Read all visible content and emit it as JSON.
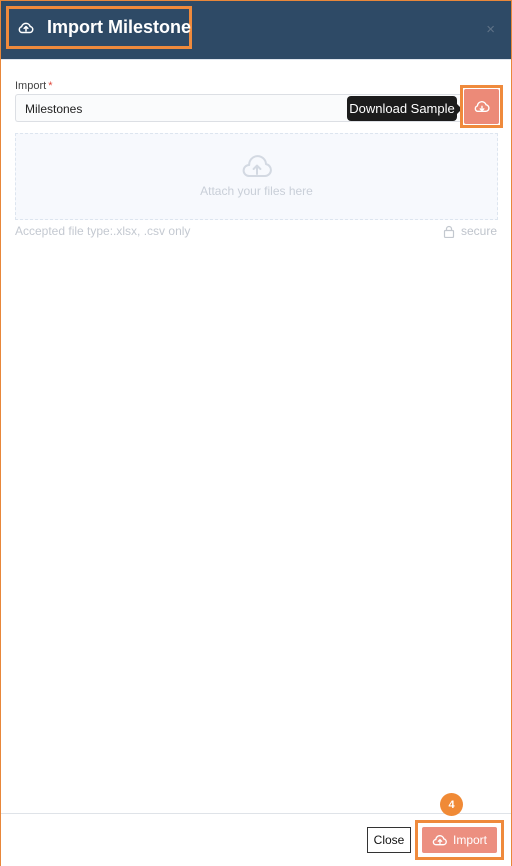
{
  "modal": {
    "title": "Import Milestone",
    "close_glyph": "×",
    "title_icon": "cloud-upload-icon",
    "close_icon": "close-icon"
  },
  "form": {
    "import_label": "Import",
    "required_mark": "*",
    "selected_value": "Milestones"
  },
  "tooltip": {
    "text": "Download Sample"
  },
  "download_button": {
    "icon": "cloud-download-icon"
  },
  "dropzone": {
    "text": "Attach your files here",
    "icon": "cloud-upload-icon"
  },
  "hints": {
    "accepted": "Accepted file type:.xlsx, .csv only",
    "secure": "secure",
    "secure_icon": "lock-icon"
  },
  "footer": {
    "close_label": "Close",
    "import_label": "Import",
    "step_number": "4"
  },
  "colors": {
    "header_bg": "#2e4a66",
    "highlight": "#ef8a3c",
    "accent": "#ec8a78"
  }
}
